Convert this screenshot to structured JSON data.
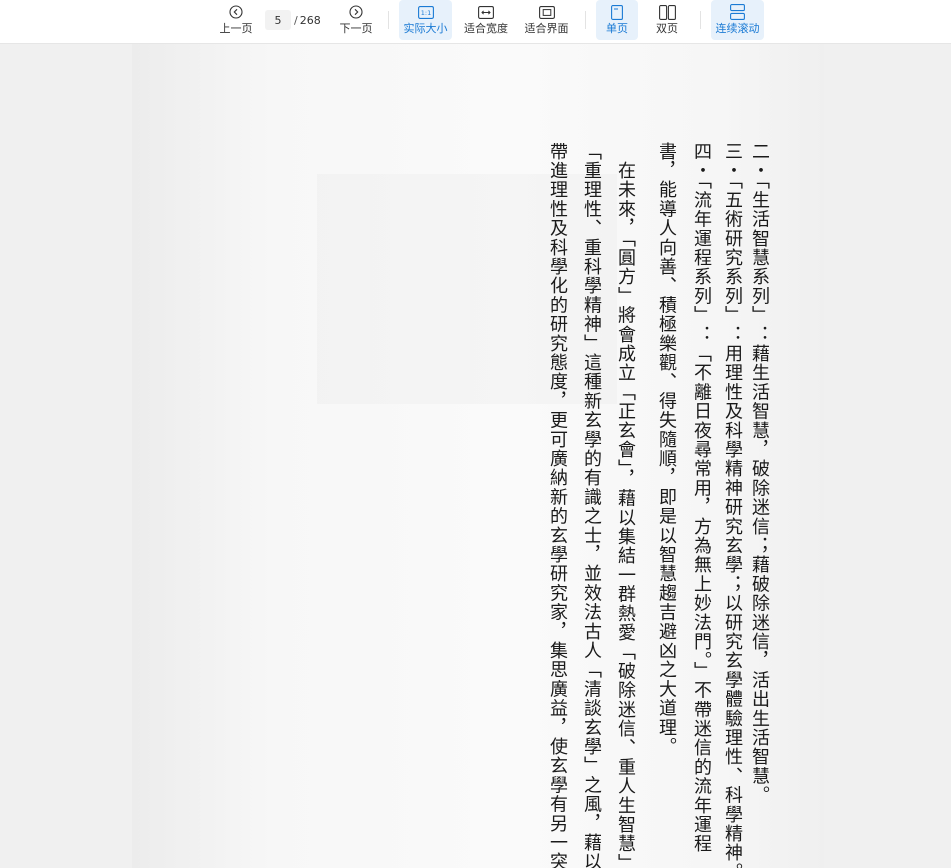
{
  "toolbar": {
    "prev_label": "上一页",
    "current_page": "5",
    "separator": "/",
    "total_pages": "268",
    "next_label": "下一页",
    "actual_size_label": "实际大小",
    "actual_size_icon_text": "1:1",
    "fit_width_label": "适合宽度",
    "fit_page_label": "适合界面",
    "single_page_label": "单页",
    "double_page_label": "双页",
    "continuous_label": "连续滚动",
    "active_color": "#1a7ad4",
    "active_bg": "#e7f1fb"
  },
  "document": {
    "lines": [
      "二・「生活智慧系列」：藉生活智慧，破除迷信；藉破除迷信，活出生活智慧。",
      "三・「五術研究系列」：用理性及科學精神研究玄學；以研究玄學體驗理性、科學精神。",
      "四・「流年運程系列」：「不離日夜尋常用，方為無上妙法門。」不帶迷信的流年運程",
      "書，能導人向善、積極樂觀、得失隨順，即是以智慧趨吉避凶之大道理。",
      "　在未來，「圓方」將會成立「正玄會」，藉以集結一群熱愛「破除迷信、重人生智慧」及",
      "「重理性、重科學精神」這種新玄學的有識之士，並效法古人「清談玄學」之風，藉以把玄學",
      "帶進理性及科學化的研究態度，更可廣納新的玄學研究家，集思廣益，使玄學有另一突破。"
    ]
  }
}
